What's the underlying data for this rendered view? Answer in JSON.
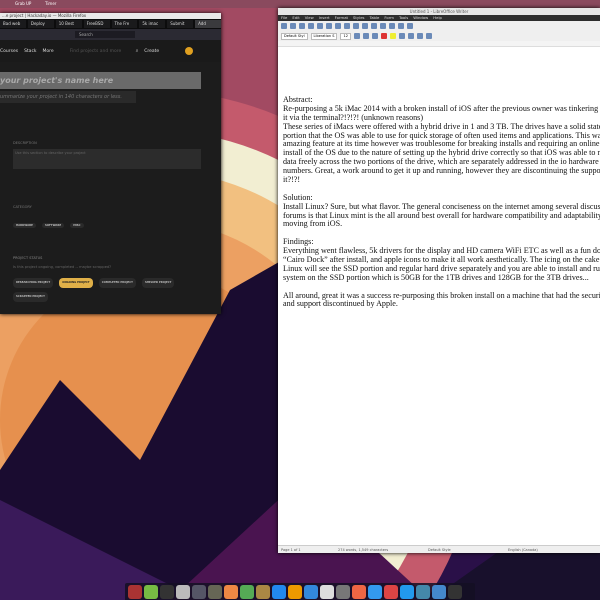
{
  "topbar": {
    "items": [
      "Grab UP",
      "Timer"
    ]
  },
  "firefox": {
    "title": "...e project | Hackaday.io — Mozilla Firefox",
    "tabs": [
      "Bad web",
      "Deploy",
      "10 Best",
      "FreeBSD",
      "The Fre",
      "5k imac",
      "Submit",
      "Add"
    ],
    "search_placeholder": "Search",
    "nav": {
      "courses": "Courses",
      "stack": "Stack",
      "more": "More",
      "find_placeholder": "Find projects and more",
      "create": "Create"
    },
    "form": {
      "name_placeholder": "your project's name here",
      "summary_placeholder": "ummarize your project in 140 characters or less.",
      "description_label": "DESCRIPTION",
      "description_placeholder": "Use this section to describe your project",
      "category_label": "CATEGORY",
      "categories": [
        "HARDWARE",
        "SOFTWARE",
        "MISC"
      ],
      "status_label": "PROJECT STATUS",
      "status_question": "Is this project ongoing, completed -- maybe scrapped?",
      "statuses": [
        "RESEARCHING PROJECT",
        "ONGOING PROJECT",
        "COMPLETED PROJECT",
        "SHELVED PROJECT",
        "SCRAPPED PROJECT"
      ],
      "selected_status": "ONGOING PROJECT"
    }
  },
  "writer": {
    "title": "Untitled 1 - LibreOffice Writer",
    "menu": [
      "File",
      "Edit",
      "View",
      "Insert",
      "Format",
      "Styles",
      "Table",
      "Form",
      "Tools",
      "Window",
      "Help"
    ],
    "para_style": "Default Styl",
    "font": "Liberation S",
    "size": "12",
    "lines": [
      "Abstract:",
      "Re-purposing a 5k iMac 2014 with a broken install of iOS after the previous owner was tinkering wit",
      "it via the terminal?!?!?! (unknown reasons)",
      "These series of iMacs were offered with a hybrid drive in 1 and 3 TB. The drives have a solid state",
      "portion that the OS was able to use for quick storage of often used items and applications. This was an",
      "amazing feature at its time however was troublesome for breaking installs and requiring an online",
      "install of the OS due to the nature of setting up the hybrid drive correctly so that iOS was able to mov",
      "data freely across the two portions of the drive, which are separately addressed in the io hardware",
      "numbers. Great, a work around to get it up and running, however they are discontinuing the support fo",
      "it?!?!",
      "",
      "Solution:",
      "Install Linux? Sure, but what flavor. The general conciseness on the internet among several discussion",
      "forums is that Linux mint is the all around best overall for hardware compatibility and adaptability",
      "moving from iOS.",
      "",
      "Findings:",
      "Everything went flawless, 5k drivers for the display and HD camera WiFi ETC as well as a fun dock",
      "“Cairo Dock” after install, and apple icons to make it all work aesthetically. The icing on the cake tho",
      "Linux will see the SSD portion and regular hard drive separately and you are able to install and run th",
      "system on the SSD portion which is 50GB for the 1TB drives and 128GB for the 3TB drives...",
      "",
      "All around, great it was a success re-purposing this broken install on a machine that had the security",
      "and support discontinued by Apple."
    ],
    "status": {
      "page": "Page 1 of 1",
      "words": "274 words, 1,549 characters",
      "style": "Default Style",
      "lang": "English (Canada)"
    }
  },
  "dock": {
    "icons": [
      "apps-grid",
      "mint-menu",
      "terminal",
      "file-manager",
      "chat",
      "package-manager",
      "drawing",
      "vlc",
      "rhythmbox",
      "dash",
      "sublime",
      "writer",
      "usb-creator",
      "speech",
      "firefox",
      "mail",
      "brave",
      "chromium",
      "network",
      "help",
      "power"
    ]
  },
  "colors": {
    "accent": "#e0b048"
  }
}
